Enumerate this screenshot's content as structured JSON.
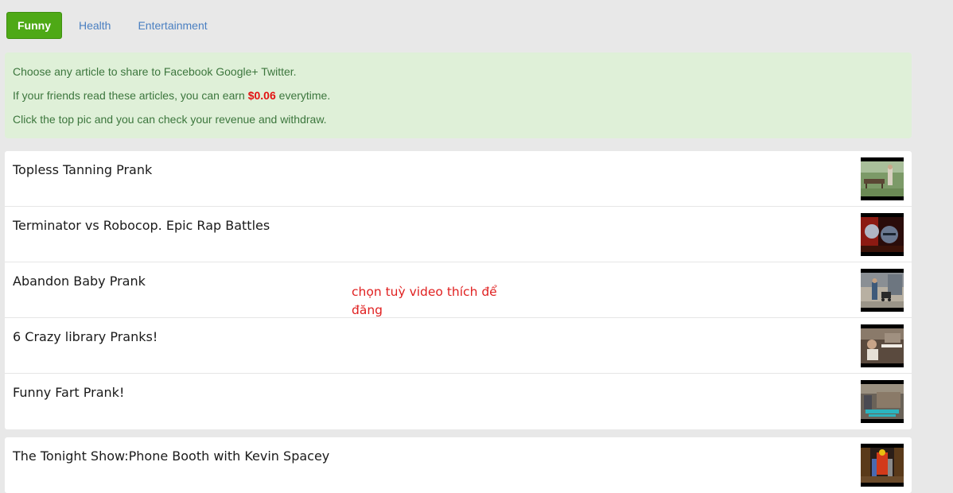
{
  "tabs": [
    {
      "label": "Funny",
      "active": true
    },
    {
      "label": "Health",
      "active": false
    },
    {
      "label": "Entertainment",
      "active": false
    }
  ],
  "notice": {
    "line1": "Choose any article to share to Facebook Google+ Twitter.",
    "line2_before": "If your friends read these articles, you can earn ",
    "line2_amount": "$0.06",
    "line2_after": " everytime.",
    "line3": "Click the top pic and you can check your revenue and withdraw."
  },
  "articles": [
    {
      "title": "Topless Tanning Prank",
      "thumbnail": "park-bench-video-thumbnail"
    },
    {
      "title": "Terminator vs Robocop. Epic Rap Battles",
      "thumbnail": "robot-faces-video-thumbnail"
    },
    {
      "title": "Abandon Baby Prank",
      "thumbnail": "stroller-street-video-thumbnail"
    },
    {
      "title": "6 Crazy library Pranks!",
      "thumbnail": "library-prank-video-thumbnail"
    },
    {
      "title": "Funny Fart Prank!",
      "thumbnail": "store-prank-video-thumbnail"
    }
  ],
  "featured": [
    {
      "title": "The Tonight Show:Phone Booth with Kevin Spacey",
      "thumbnail": "stage-show-video-thumbnail"
    }
  ],
  "annotation": "chọn tuỳ video thích để đăng",
  "colors": {
    "active_tab": "#4ea916",
    "tab_link": "#4a7fc1",
    "notice_bg": "#dff0d8",
    "notice_text": "#3c763d",
    "amount": "#e21212",
    "annotation": "#e02020"
  }
}
